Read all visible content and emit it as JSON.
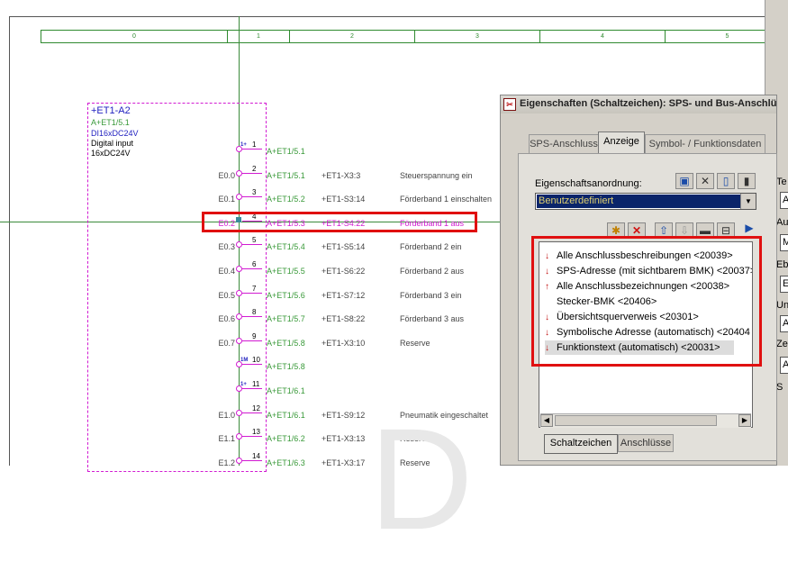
{
  "ruler": {
    "columns": [
      "0",
      "1",
      "2",
      "3",
      "4",
      "5"
    ]
  },
  "plc": {
    "title": "+ET1-A2",
    "sub1": "A+ET1/5.1",
    "sub2": "DI16xDC24V",
    "sub3": "Digital input",
    "sub4": "16xDC24V"
  },
  "rows": [
    {
      "pin": "1",
      "marker": "1+",
      "addr": "",
      "target": "A+ET1/5.1",
      "bmk": "",
      "fn": ""
    },
    {
      "pin": "2",
      "addr": "E0.0",
      "target": "A+ET1/5.1",
      "bmk": "+ET1-X3:3",
      "fn": "Steuerspannung ein"
    },
    {
      "pin": "3",
      "addr": "E0.1",
      "target": "A+ET1/5.2",
      "bmk": "+ET1-S3:14",
      "fn": "Förderband 1 einschalten"
    },
    {
      "pin": "4",
      "addr": "E0.2",
      "target": "A+ET1/5.3",
      "bmk": "+ET1-S4:22",
      "fn": "Förderband 1 aus"
    },
    {
      "pin": "5",
      "addr": "E0.3",
      "target": "A+ET1/5.4",
      "bmk": "+ET1-S5:14",
      "fn": "Förderband 2 ein"
    },
    {
      "pin": "6",
      "addr": "E0.4",
      "target": "A+ET1/5.5",
      "bmk": "+ET1-S6:22",
      "fn": "Förderband 2 aus"
    },
    {
      "pin": "7",
      "addr": "E0.5",
      "target": "A+ET1/5.6",
      "bmk": "+ET1-S7:12",
      "fn": "Förderband 3 ein"
    },
    {
      "pin": "8",
      "addr": "E0.6",
      "target": "A+ET1/5.7",
      "bmk": "+ET1-S8:22",
      "fn": "Förderband 3 aus"
    },
    {
      "pin": "9",
      "addr": "E0.7",
      "target": "A+ET1/5.8",
      "bmk": "+ET1-X3:10",
      "fn": "Reserve"
    },
    {
      "pin": "10",
      "marker": "1M",
      "addr": "",
      "target": "A+ET1/5.8",
      "bmk": "",
      "fn": ""
    },
    {
      "pin": "11",
      "marker": "1+",
      "addr": "",
      "target": "A+ET1/6.1",
      "bmk": "",
      "fn": ""
    },
    {
      "pin": "12",
      "addr": "E1.0",
      "target": "A+ET1/6.1",
      "bmk": "+ET1-S9:12",
      "fn": "Pneumatik eingeschaltet"
    },
    {
      "pin": "13",
      "addr": "E1.1",
      "target": "A+ET1/6.2",
      "bmk": "+ET1-X3:13",
      "fn": "Reserve"
    },
    {
      "pin": "14",
      "addr": "E1.2",
      "target": "A+ET1/6.3",
      "bmk": "+ET1-X3:17",
      "fn": "Reserve"
    }
  ],
  "watermark": "D",
  "dialog": {
    "title": "Eigenschaften (Schaltzeichen): SPS- und Bus-Anschlü",
    "tabs": [
      "SPS-Anschluss",
      "Anzeige",
      "Symbol- / Funktionsdaten"
    ],
    "active_tab": "Anzeige",
    "arrangement_label": "Eigenschaftsanordnung:",
    "arrangement_value": "Benutzerdefiniert",
    "properties": [
      {
        "arrow": "↓",
        "text": "Alle Anschlussbeschreibungen <20039>"
      },
      {
        "arrow": "↓",
        "text": "SPS-Adresse (mit sichtbarem BMK) <20037>"
      },
      {
        "arrow": "↑",
        "text": "Alle Anschlussbezeichnungen <20038>"
      },
      {
        "arrow": "",
        "text": "Stecker-BMK <20406>"
      },
      {
        "arrow": "↓",
        "text": "Übersichtsquerverweis <20301>"
      },
      {
        "arrow": "↓",
        "text": "Symbolische Adresse (automatisch) <20404"
      },
      {
        "arrow": "↓",
        "text": "Funktionstext (automatisch) <20031>"
      }
    ],
    "bottom_tabs": [
      "Schaltzeichen",
      "Anschlüsse"
    ],
    "right_labels": [
      "Te",
      "Au",
      "Eb",
      "Un",
      "Ze",
      "S"
    ],
    "right_fields": [
      "A",
      "M",
      "El",
      "A",
      "A"
    ]
  },
  "colors": {
    "accent_red": "#e01010",
    "wire_magenta": "#d21bd2",
    "ref_green": "#3a9a3a",
    "title_blue": "#1f1fbf"
  }
}
